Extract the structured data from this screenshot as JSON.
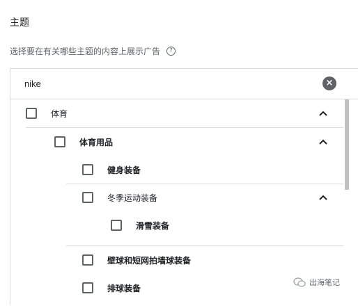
{
  "header": {
    "title": "主题",
    "subtitle": "选择要在有关哪些主题的内容上展示广告",
    "help_icon": "?"
  },
  "search": {
    "value": "nike",
    "clear_icon": "×"
  },
  "tree": {
    "items": [
      {
        "label": "体育",
        "level": 0,
        "checked": false,
        "expanded": true
      },
      {
        "label": "体育用品",
        "level": 1,
        "checked": false,
        "expanded": true
      },
      {
        "label": "健身装备",
        "level": 2,
        "checked": false
      },
      {
        "label": "冬季运动装备",
        "level": 2,
        "checked": false,
        "expanded": true
      },
      {
        "label": "滑雪装备",
        "level": 3,
        "checked": false
      },
      {
        "label": "壁球和短网拍墙球装备",
        "level": 2,
        "checked": false
      },
      {
        "label": "排球装备",
        "level": 2,
        "checked": false
      }
    ]
  },
  "watermark": {
    "text": "出海笔记"
  }
}
